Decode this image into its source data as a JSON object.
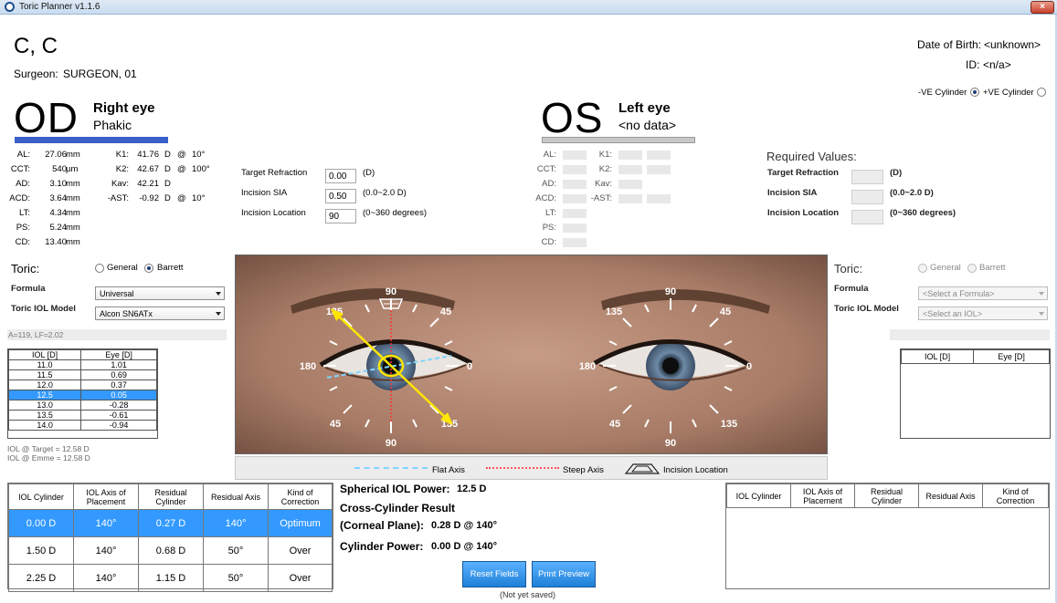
{
  "window": {
    "title": "Toric Planner v1.1.6",
    "close_label": "×"
  },
  "patient": {
    "name": "C, C",
    "surgeon_label": "Surgeon:",
    "surgeon_value": "SURGEON, 01",
    "dob_label": "Date of Birth:",
    "dob_value": "<unknown>",
    "id_label": "ID:",
    "id_value": "<n/a>"
  },
  "cylinder_toggle": {
    "neg_label": "-VE Cylinder",
    "pos_label": "+VE Cylinder",
    "selected": "neg"
  },
  "od": {
    "abbr": "OD",
    "title": "Right eye",
    "status": "Phakic",
    "bar_color": "#3a5fc8",
    "measurements": [
      {
        "label": "AL:",
        "value": "27.06",
        "unit": "mm"
      },
      {
        "label": "CCT:",
        "value": "540",
        "unit": "µm"
      },
      {
        "label": "AD:",
        "value": "3.10",
        "unit": "mm"
      },
      {
        "label": "ACD:",
        "value": "3.64",
        "unit": "mm"
      },
      {
        "label": "LT:",
        "value": "4.34",
        "unit": "mm"
      },
      {
        "label": "PS:",
        "value": "5.24",
        "unit": "mm"
      },
      {
        "label": "CD:",
        "value": "13.40",
        "unit": "mm"
      }
    ],
    "keratometry": [
      {
        "label": "K1:",
        "value": "41.76",
        "unit": "D",
        "at": "@",
        "axis": "10°"
      },
      {
        "label": "K2:",
        "value": "42.67",
        "unit": "D",
        "at": "@",
        "axis": "100°"
      },
      {
        "label": "Kav:",
        "value": "42.21",
        "unit": "D",
        "at": "",
        "axis": ""
      },
      {
        "label": "-AST:",
        "value": "-0.92",
        "unit": "D",
        "at": "@",
        "axis": "10°"
      }
    ],
    "target_refraction_label": "Target Refraction",
    "target_refraction_value": "0.00",
    "target_refraction_unit": "(D)",
    "incision_sia_label": "Incision SIA",
    "incision_sia_value": "0.50",
    "incision_sia_unit": "(0.0~2.0 D)",
    "incision_location_label": "Incision Location",
    "incision_location_value": "90",
    "incision_location_unit": "(0~360 degrees)",
    "toric_label": "Toric:",
    "general_label": "General",
    "barrett_label": "Barrett",
    "formula_label": "Formula",
    "formula_value": "Universal",
    "iol_model_label": "Toric IOL Model",
    "iol_model_value": "Alcon SN6ATx",
    "a_constant": "A=119, LF=2.02",
    "iol_table": {
      "headers": [
        "IOL [D]",
        "Eye [D]"
      ],
      "rows": [
        [
          "11.0",
          "1.01"
        ],
        [
          "11.5",
          "0.69"
        ],
        [
          "12.0",
          "0.37"
        ],
        [
          "12.5",
          "0.05"
        ],
        [
          "13.0",
          "-0.28"
        ],
        [
          "13.5",
          "-0.61"
        ],
        [
          "14.0",
          "-0.94"
        ]
      ],
      "selected_index": 3
    },
    "iol_at_target": "IOL @ Target = 12.58 D",
    "iol_at_emme": "IOL @ Emme = 12.58 D"
  },
  "os": {
    "abbr": "OS",
    "title": "Left eye",
    "status": "<no data>",
    "bar_color": "#c8c8c8",
    "measurement_labels": [
      "AL:",
      "CCT:",
      "AD:",
      "ACD:",
      "LT:",
      "PS:",
      "CD:"
    ],
    "kerat_labels": [
      "K1:",
      "K2:",
      "Kav:",
      "-AST:"
    ],
    "required_title": "Required Values:",
    "target_refraction_label": "Target Refraction",
    "target_refraction_unit": "(D)",
    "incision_sia_label": "Incision SIA",
    "incision_sia_unit": "(0.0~2.0 D)",
    "incision_location_label": "Incision Location",
    "incision_location_unit": "(0~360 degrees)",
    "toric_label": "Toric:",
    "general_label": "General",
    "barrett_label": "Barrett",
    "formula_label": "Formula",
    "formula_placeholder": "<Select a Formula>",
    "iol_model_label": "Toric IOL Model",
    "iol_model_placeholder": "<Select an IOL>",
    "iol_table_headers": [
      "IOL [D]",
      "Eye [D]"
    ]
  },
  "eye_image": {
    "left_dial": [
      "90",
      "45",
      "0",
      "135",
      "90",
      "45",
      "180",
      "135"
    ],
    "right_dial": [
      "90",
      "45",
      "0",
      "135",
      "90",
      "45",
      "180",
      "135"
    ]
  },
  "legend": {
    "flat": "Flat Axis",
    "steep": "Steep Axis",
    "incision": "Incision Location"
  },
  "results": {
    "headers": [
      "IOL Cylinder",
      "IOL Axis of Placement",
      "Residual Cylinder",
      "Residual Axis",
      "Kind of Correction"
    ],
    "rows": [
      [
        "0.00 D",
        "140°",
        "0.27 D",
        "140°",
        "Optimum"
      ],
      [
        "1.50 D",
        "140°",
        "0.68 D",
        "50°",
        "Over"
      ],
      [
        "2.25 D",
        "140°",
        "1.15 D",
        "50°",
        "Over"
      ]
    ],
    "selected_index": 0,
    "spherical_label": "Spherical IOL Power:",
    "spherical_value": "12.5 D",
    "cross_label_1": "Cross-Cylinder Result",
    "cross_label_2": "(Corneal Plane):",
    "cross_value": "0.28 D @ 140°",
    "cyl_label": "Cylinder Power:",
    "cyl_value": "0.00 D @ 140°",
    "reset_label": "Reset Fields",
    "print_label": "Print Preview",
    "save_status": "(Not yet saved)"
  }
}
